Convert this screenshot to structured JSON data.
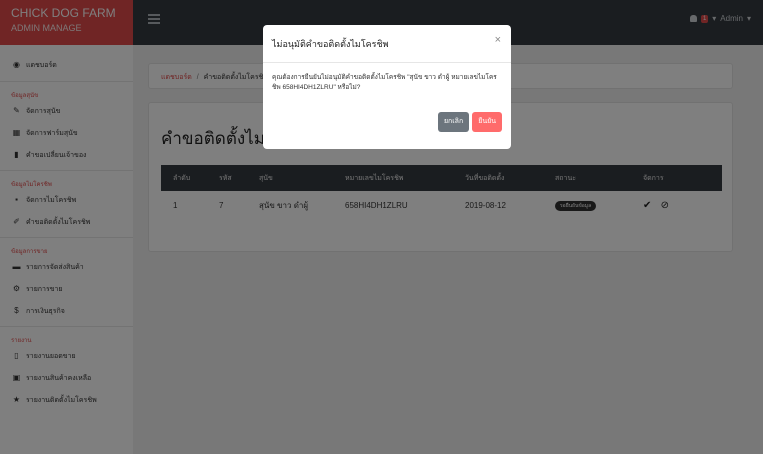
{
  "brand": {
    "title": "CHICK DOG FARM",
    "subtitle": "ADMIN MANAGE"
  },
  "topbar": {
    "notif_count": "1",
    "user": "Admin",
    "user_caret": "▾"
  },
  "sidebar": {
    "dashboard": "แดชบอร์ด",
    "groups": [
      {
        "header": "ข้อมูลสุนัข",
        "items": [
          {
            "label": "จัดการสุนัข",
            "icon": "paw-icon"
          },
          {
            "label": "จัดการฟาร์มสุนัข",
            "icon": "farm-icon"
          },
          {
            "label": "คำขอเปลี่ยนเจ้าของ",
            "icon": "bookmark-icon"
          }
        ]
      },
      {
        "header": "ข้อมูลไมโครชิพ",
        "items": [
          {
            "label": "จัดการไมโครชิพ",
            "icon": "chip-icon"
          },
          {
            "label": "คำขอติดตั้งไมโครชิพ",
            "icon": "pen-icon"
          }
        ]
      },
      {
        "header": "ข้อมูลการขาย",
        "items": [
          {
            "label": "รายการจัดส่งสินค้า",
            "icon": "truck-icon"
          },
          {
            "label": "รายการขาย",
            "icon": "cart-icon"
          },
          {
            "label": "การเงินธุรกิจ",
            "icon": "dollar-icon"
          }
        ]
      },
      {
        "header": "รายงาน",
        "items": [
          {
            "label": "รายงานยอดขาย",
            "icon": "file-icon"
          },
          {
            "label": "รายงานสินค้าคงเหลือ",
            "icon": "box-icon"
          },
          {
            "label": "รายงานติดตั้งไมโครชิพ",
            "icon": "star-icon"
          }
        ]
      }
    ]
  },
  "breadcrumb": {
    "home": "แดชบอร์ด",
    "separator": "/",
    "current": "คำขอติดตั้งไมโครชิพ"
  },
  "page": {
    "title": "คำขอติดตั้งไมโครชิพ"
  },
  "table": {
    "headers": [
      "ลำดับ",
      "รหัส",
      "สุนัข",
      "หมายเลขไมโครชิพ",
      "วันที่ขอติดตั้ง",
      "สถานะ",
      "จัดการ"
    ],
    "rows": [
      {
        "no": "1",
        "id": "7",
        "dog": "สุนัข ขาว ดำผู้",
        "chip": "658HI4DH1ZLRU",
        "date": "2019-08-12",
        "status": "รอยืนยันข้อมูล"
      }
    ]
  },
  "modal": {
    "title": "ไม่อนุมัติคำขอติดตั้งไมโครชิพ",
    "close": "×",
    "message": "คุณต้องการยืนยันไม่อนุมัติคำขอติดตั้งไมโครชิพ \"สุนัข ขาว ดำผู้ หมายเลขไมโครชิพ 658HI4DH1ZLRU\" หรือไม่?",
    "cancel_label": "ยกเลิก",
    "confirm_label": "ยืนยัน"
  },
  "colors": {
    "brand": "#e04a4a",
    "topbar": "#343a40",
    "confirm": "#ff6b6b",
    "cancel": "#6c757d"
  }
}
